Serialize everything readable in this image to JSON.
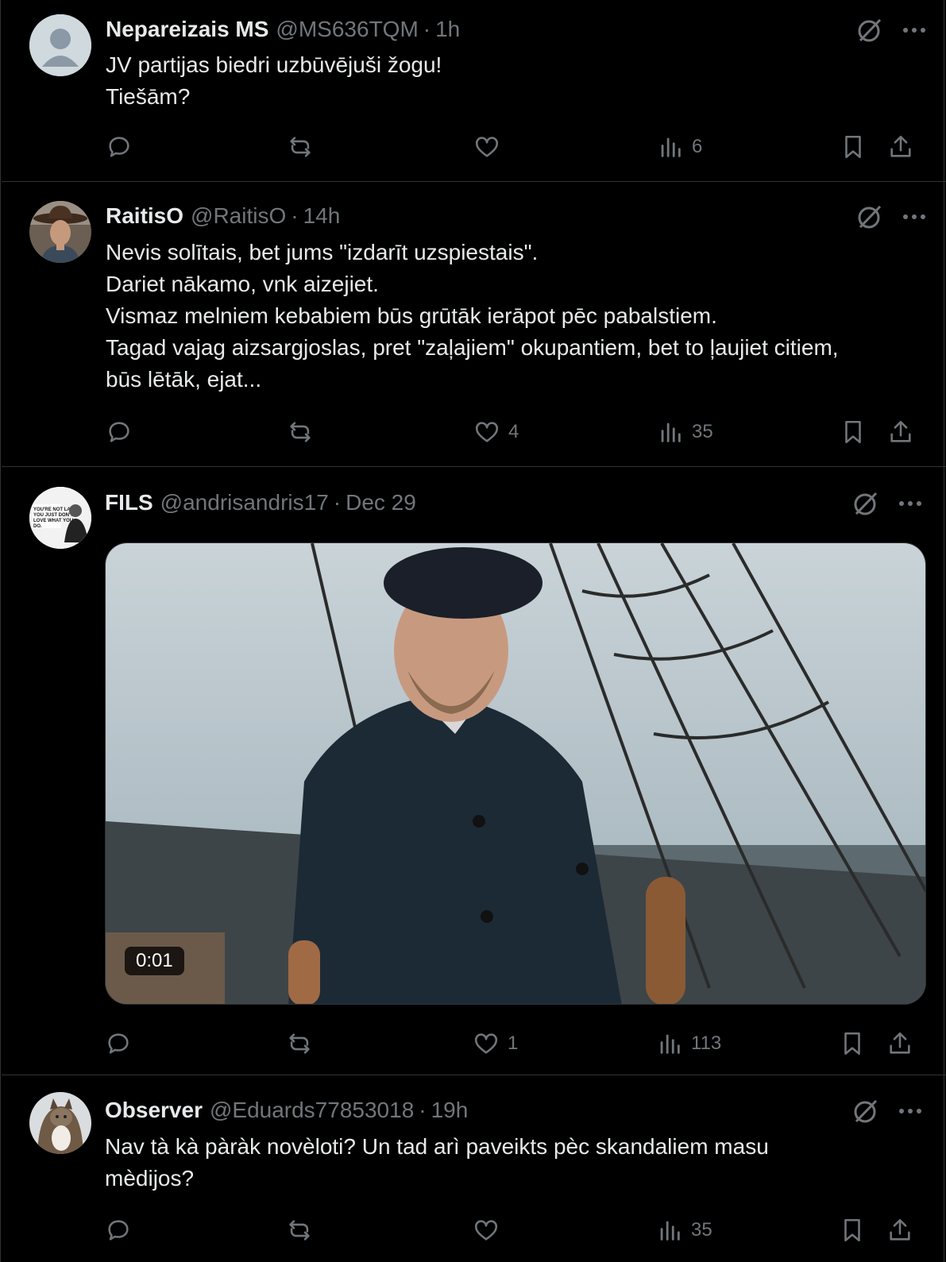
{
  "posts": [
    {
      "name": "Nepareizais MS",
      "handle": "@MS636TQM",
      "sep": "·",
      "time": "1h",
      "lines": [
        "JV partijas biedri uzbūvējuši žogu!",
        "Tiešām?"
      ],
      "likes": "",
      "views": "6"
    },
    {
      "name": "RaitisO",
      "handle": "@RaitisO",
      "sep": "·",
      "time": "14h",
      "lines": [
        "Nevis solītais, bet jums \"izdarīt uzspiestais\".",
        "Dariet nākamo, vnk aizejiet.",
        "Vismaz melniem kebabiem būs grūtāk ierāpot pēc pabalstiem.",
        "Tagad vajag aizsargjoslas, pret \"zaļajiem\" okupantiem, bet to ļaujiet citiem,",
        "būs lētāk, ejat..."
      ],
      "likes": "4",
      "views": "35"
    },
    {
      "name": "FILS",
      "handle": "@andrisandris17",
      "sep": "·",
      "time": "Dec 29",
      "lines": [],
      "video_duration": "0:01",
      "avatar_text": "YOU'RE NOT LAZY, YOU JUST DON'T LOVE WHAT YOU DO.",
      "likes": "1",
      "views": "113"
    },
    {
      "name": "Observer",
      "handle": "@Eduards77853018",
      "sep": "·",
      "time": "19h",
      "lines": [
        "Nav tà kà pàràk novèloti? Un tad arì paveikts pèc skandaliem masu",
        "mèdijos?"
      ],
      "likes": "",
      "views": "35"
    }
  ],
  "icons": {
    "reply": "reply-icon",
    "repost": "repost-icon",
    "like": "like-icon",
    "views": "views-icon",
    "bookmark": "bookmark-icon",
    "share": "share-icon",
    "grok": "grok-icon",
    "more": "more-icon"
  },
  "colors": {
    "background": "#000000",
    "text": "#e7e9ea",
    "muted": "#71767b",
    "divider": "#2f3336"
  }
}
